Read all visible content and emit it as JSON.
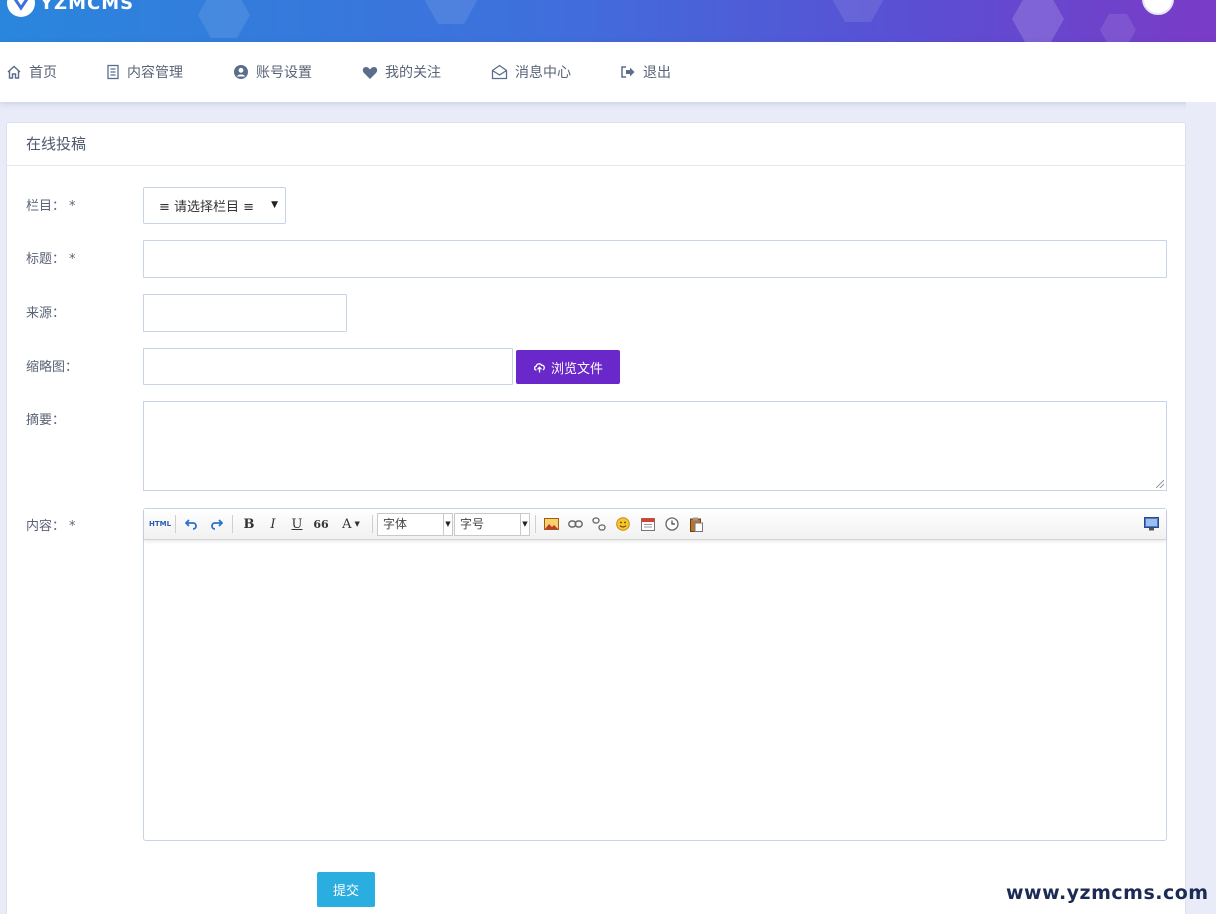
{
  "brand": {
    "logo_text": "YZMCMS"
  },
  "nav": {
    "items": [
      {
        "label": "首页",
        "icon": "home-icon"
      },
      {
        "label": "内容管理",
        "icon": "document-icon"
      },
      {
        "label": "账号设置",
        "icon": "user-circle-icon"
      },
      {
        "label": "我的关注",
        "icon": "heart-icon"
      },
      {
        "label": "消息中心",
        "icon": "envelope-open-icon"
      },
      {
        "label": "退出",
        "icon": "sign-out-icon"
      }
    ]
  },
  "panel": {
    "title": "在线投稿"
  },
  "form": {
    "category_label": "栏目：",
    "category_selected": "≡ 请选择栏目 ≡",
    "title_label": "标题：",
    "source_label": "来源：",
    "thumbnail_label": "缩略图：",
    "browse_label": "浏览文件",
    "summary_label": "摘要：",
    "content_label": "内容：",
    "required_mark": "*",
    "submit_label": "提交"
  },
  "editor": {
    "html_label": "HTML",
    "bold": "B",
    "italic": "I",
    "underline": "U",
    "quote": "66",
    "font_color": "A",
    "font_family_placeholder": "字体",
    "font_size_placeholder": "字号"
  },
  "watermark": "www.yzmcms.com",
  "colors": {
    "browse_button": "#6a27c9",
    "submit_button": "#2aaee0",
    "nav_icon": "#5a6e8c"
  }
}
